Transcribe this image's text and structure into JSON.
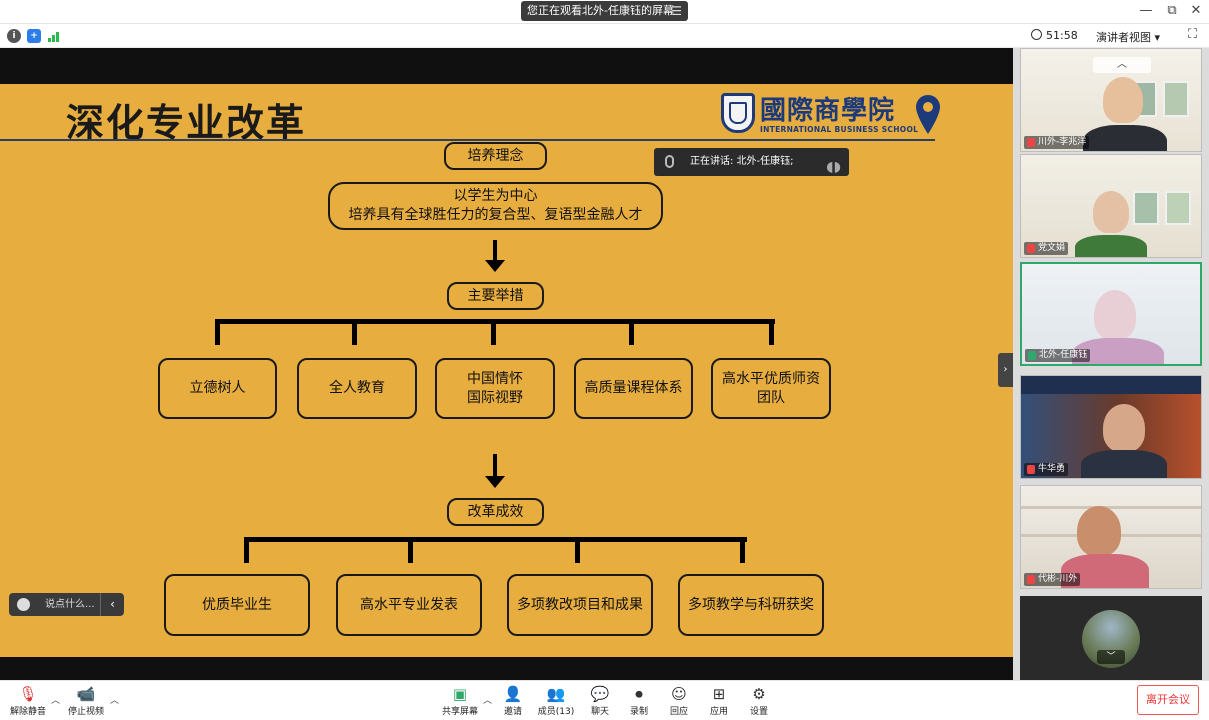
{
  "window": {
    "watching_banner": "您正在观看北外-任康钰的屏幕",
    "menu_glyph": "☰",
    "minimize": "—",
    "restore": "⧉",
    "close": "✕"
  },
  "infobar": {
    "elapsed_time": "51:58",
    "view_mode": "演讲者视图 ▾",
    "fullscreen": "⛶"
  },
  "slide": {
    "title": "深化专业改革",
    "logo_cn": "國際商學院",
    "logo_en": "INTERNATIONAL BUSINESS SCHOOL",
    "section1_label": "培养理念",
    "philosophy_line1": "以学生为中心",
    "philosophy_line2": "培养具有全球胜任力的复合型、复语型金融人才",
    "section2_label": "主要举措",
    "measures": [
      "立德树人",
      "全人教育",
      "中国情怀\n国际视野",
      "高质量课程体系",
      "高水平优质师资\n团队"
    ],
    "section3_label": "改革成效",
    "outcomes": [
      "优质毕业生",
      "高水平专业发表",
      "多项教改项目和成果",
      "多项教学与科研获奖"
    ]
  },
  "speaking_indicator": "正在讲话: 北外-任康钰;",
  "chat_input": {
    "placeholder": "说点什么...",
    "collapse": "‹"
  },
  "panel_toggle": "›",
  "participants": [
    {
      "name": "川外-李兆洋",
      "muted": true
    },
    {
      "name": "党文娟",
      "muted": true
    },
    {
      "name": "北外-任康钰",
      "muted": false,
      "active": true
    },
    {
      "name": "牛华勇",
      "muted": true
    },
    {
      "name": "代彬-川外",
      "muted": true
    }
  ],
  "panel_scroll_up": "︿",
  "panel_scroll_down": "﹀",
  "toolbar": {
    "unmute": "解除静音",
    "stop_video": "停止视频",
    "share_screen": "共享屏幕",
    "invite": "邀请",
    "members": "成员(13)",
    "chat": "聊天",
    "record": "录制",
    "reactions": "回应",
    "apps": "应用",
    "settings": "设置",
    "leave": "离开会议"
  },
  "colors": {
    "slide_background": "#e7ad3f",
    "brand_blue": "#1d3b7a",
    "active_speaker": "#2fa86a",
    "leave_red": "#e33333"
  }
}
